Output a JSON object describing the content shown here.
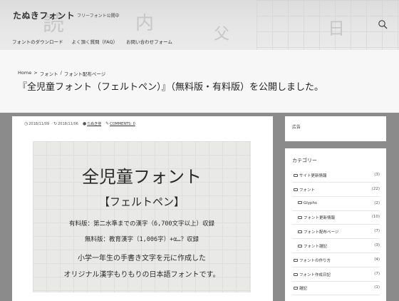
{
  "header": {
    "site_title": "たぬきフォント",
    "site_desc": "フリーフォント公開中",
    "nav": [
      "フォントのダウンロード",
      "よく頂く質問（FAQ）",
      "お問い合わせフォーム"
    ]
  },
  "breadcrumb": [
    "Home",
    ">",
    "フォント",
    "/",
    "フォント配布ページ"
  ],
  "page_title": "『全児童フォント（フェルトペン）』（無料版・有料版）を公開しました。",
  "post_meta": {
    "published": "2018/11/09",
    "updated": "2018/11/06",
    "author": "たぬき侍",
    "comments": "COMMENTS: 0"
  },
  "featured_image": {
    "lines": [
      "全児童フォント",
      "【フェルトペン】",
      "有料版：第二水準までの漢字（6,700文字以上）収録",
      "無料版：教育漢字（1,006字）+α…？収録",
      "小学一年生の手書き文字を元に作成した",
      "オリジナル漢字もりもりの日本語フォントです。"
    ]
  },
  "sidebar": {
    "ad_label": "広告",
    "categories_title": "カテゴリー",
    "categories": [
      {
        "label": "サイト更新情報",
        "count": "(3)",
        "indent": 0
      },
      {
        "label": "フォント",
        "count": "(22)",
        "indent": 0
      },
      {
        "label": "Glyphs",
        "count": "(2)",
        "indent": 1
      },
      {
        "label": "フォント更新情報",
        "count": "(10)",
        "indent": 1
      },
      {
        "label": "フォント配布ページ",
        "count": "(7)",
        "indent": 1
      },
      {
        "label": "フォント雑記",
        "count": "(3)",
        "indent": 1
      },
      {
        "label": "フォントの作り方",
        "count": "(4)",
        "indent": 0
      },
      {
        "label": "フォント作成日記",
        "count": "(7)",
        "indent": 0
      },
      {
        "label": "雑記",
        "count": "(1)",
        "indent": 0
      }
    ]
  }
}
